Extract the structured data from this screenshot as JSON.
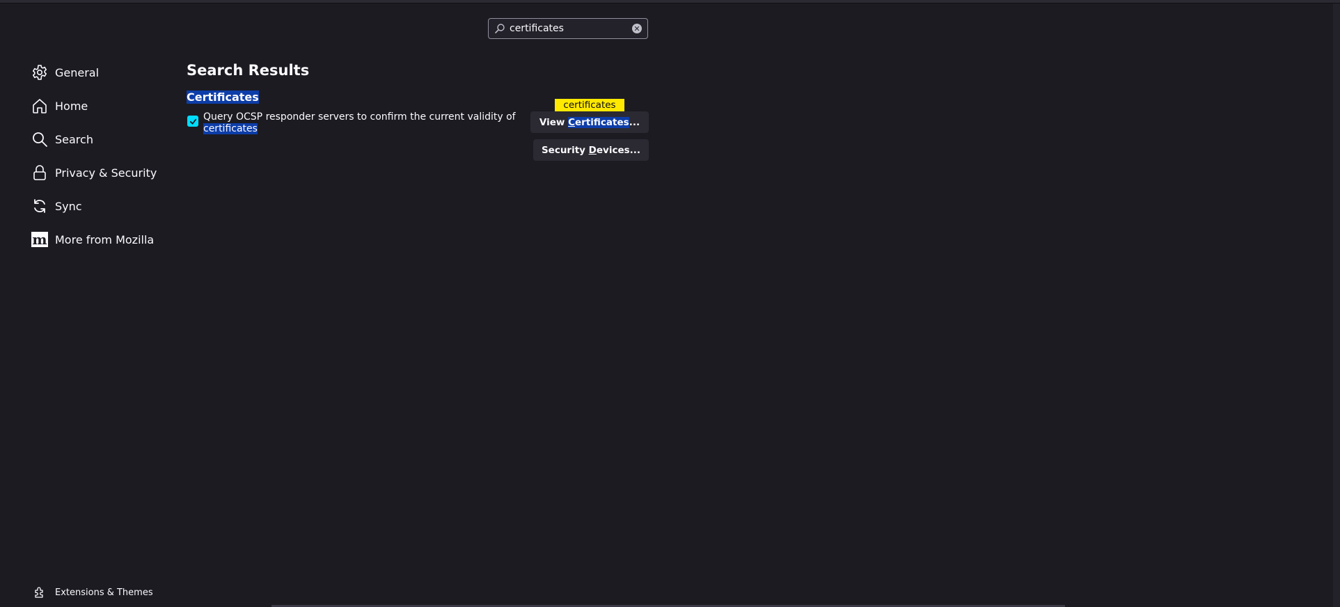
{
  "search": {
    "value": "certificates",
    "icon": "search-icon",
    "clear_icon": "clear-icon"
  },
  "sidebar": {
    "items": [
      {
        "label": "General",
        "icon": "gear-icon"
      },
      {
        "label": "Home",
        "icon": "home-icon"
      },
      {
        "label": "Search",
        "icon": "search-icon"
      },
      {
        "label": "Privacy & Security",
        "icon": "lock-icon"
      },
      {
        "label": "Sync",
        "icon": "sync-icon"
      },
      {
        "label": "More from Mozilla",
        "icon": "mozilla-icon"
      }
    ],
    "footer": {
      "label": "Extensions & Themes",
      "icon": "puzzle-icon"
    }
  },
  "main": {
    "title": "Search Results",
    "section_title": "Certificates",
    "ocsp": {
      "checked": true,
      "text_before": "Query OCSP responder servers to confirm the current validity of",
      "text_match": "certificates"
    },
    "buttons": {
      "view": {
        "pre": "View ",
        "accesskey": "C",
        "match_rest": "ertificates",
        "post": "..."
      },
      "security": {
        "pre": "Security ",
        "accesskey": "D",
        "rest": "evices..."
      }
    },
    "tooltip": "certificates"
  },
  "colors": {
    "background": "#1c1b22",
    "highlight": "#0d3da8",
    "checkbox": "#00ddff",
    "tooltip": "#ffe900"
  }
}
